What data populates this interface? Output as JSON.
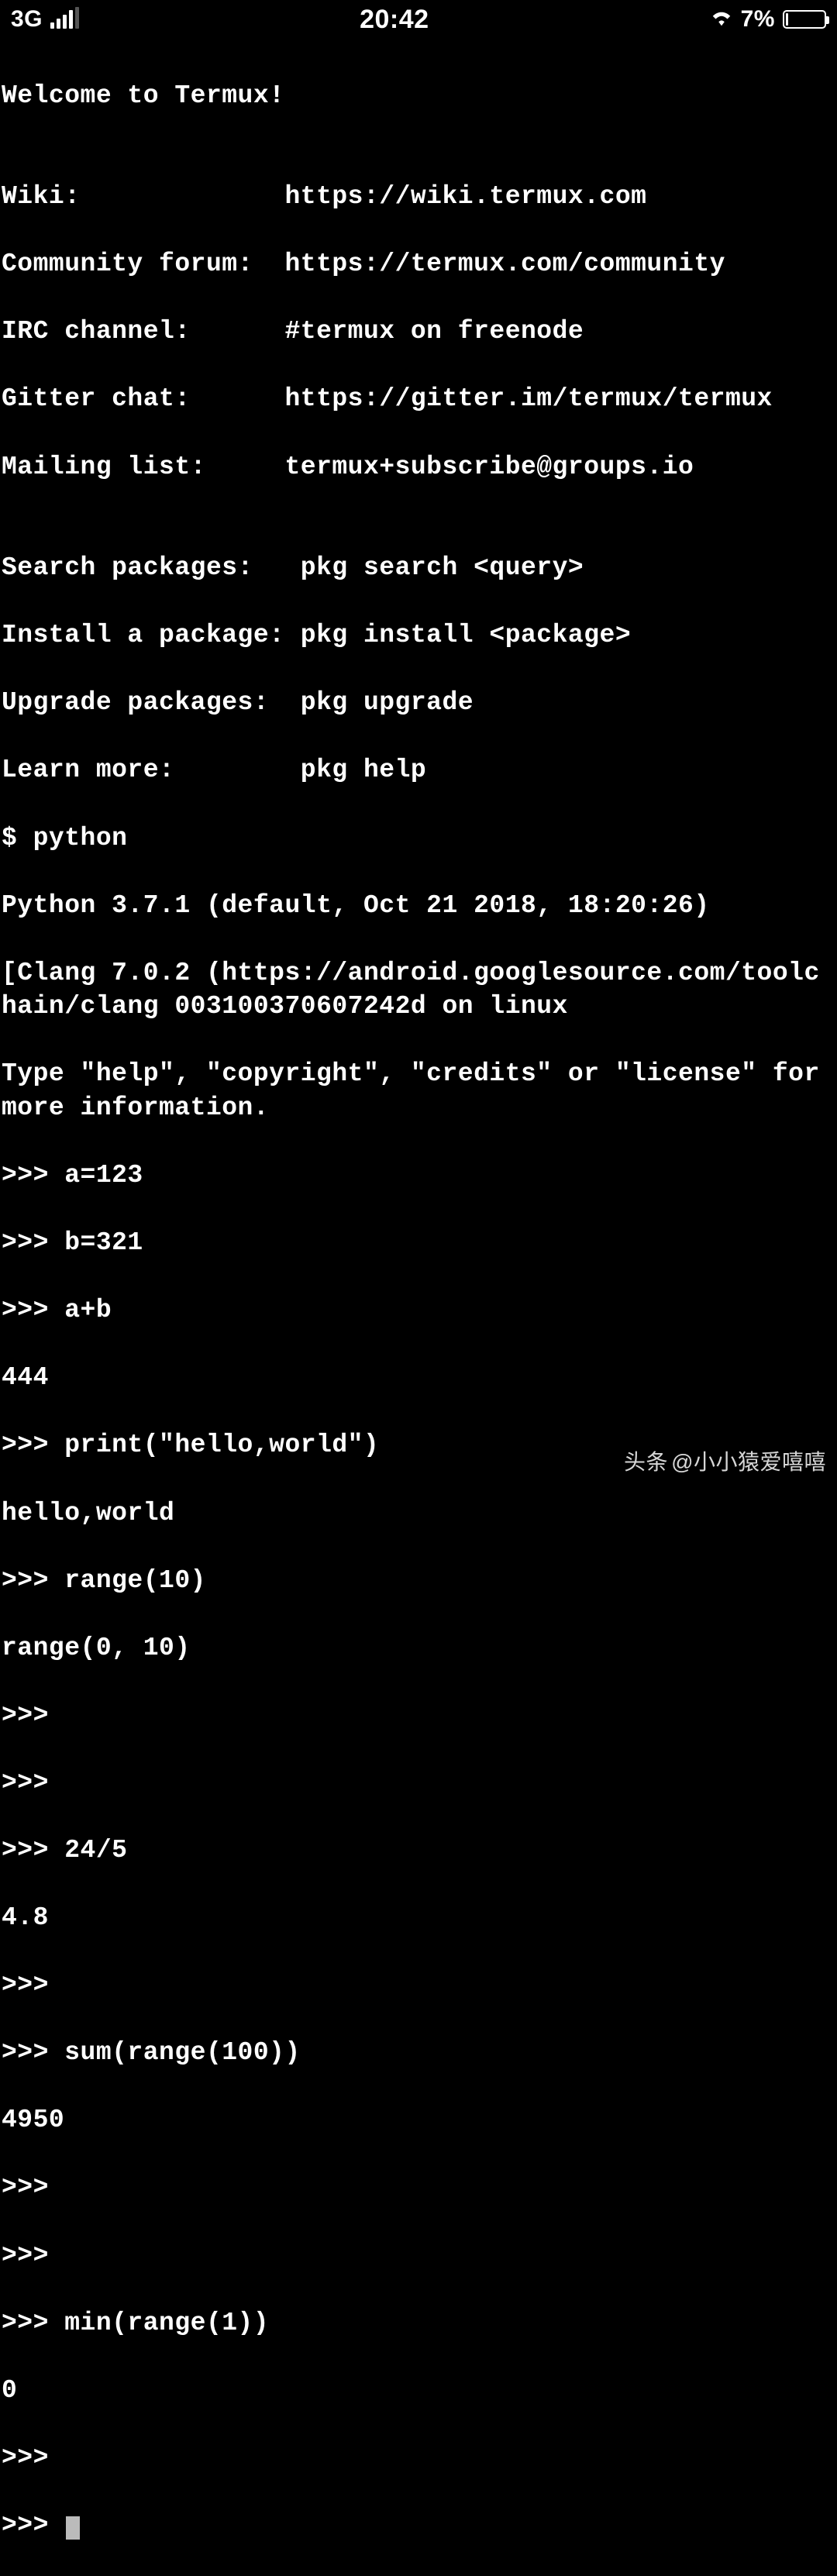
{
  "status": {
    "network": "3G",
    "time": "20:42",
    "battery_pct": "7%"
  },
  "terminal": {
    "welcome": "Welcome to Termux!",
    "blank1": "",
    "wiki": "Wiki:             https://wiki.termux.com",
    "forum": "Community forum:  https://termux.com/community",
    "irc": "IRC channel:      #termux on freenode",
    "gitter": "Gitter chat:      https://gitter.im/termux/termux",
    "mailing": "Mailing list:     termux+subscribe@groups.io",
    "blank2": "",
    "search": "Search packages:   pkg search <query>",
    "install": "Install a package: pkg install <package>",
    "upgrade": "Upgrade packages:  pkg upgrade",
    "learn": "Learn more:        pkg help",
    "cmd_python": "$ python",
    "py_version": "Python 3.7.1 (default, Oct 21 2018, 18:20:26)",
    "clang": "[Clang 7.0.2 (https://android.googlesource.com/toolchain/clang 003100370607242d on linux",
    "help": "Type \"help\", \"copyright\", \"credits\" or \"license\" for more information.",
    "p1": ">>> a=123",
    "p2": ">>> b=321",
    "p3": ">>> a+b",
    "r3": "444",
    "p4": ">>> print(\"hello,world\")",
    "r4": "hello,world",
    "p5": ">>> range(10)",
    "r5": "range(0, 10)",
    "p6": ">>> ",
    "p7": ">>> ",
    "p8": ">>> 24/5",
    "r8": "4.8",
    "p9": ">>> ",
    "p10": ">>> sum(range(100))",
    "r10": "4950",
    "p11": ">>> ",
    "p12": ">>> ",
    "p13": ">>> min(range(1))",
    "r13": "0",
    "p14": ">>> ",
    "p15": ">>> "
  },
  "watermark": {
    "brand": "头条",
    "author": "@小小猿爱嘻嘻"
  }
}
